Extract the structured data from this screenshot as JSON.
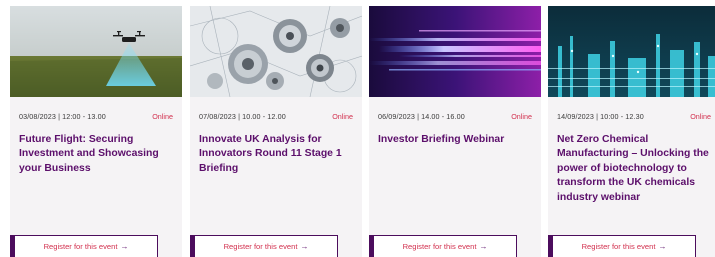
{
  "events": [
    {
      "date": "03/08/2023 | 12:00 - 13.00",
      "mode": "Online",
      "title": "Future Flight: Securing Investment and Showcasing your Business",
      "register_label": "Register for this event",
      "register_arrow": "→",
      "image_icon": "drone-over-field-image"
    },
    {
      "date": "07/08/2023 | 10.00 - 12.00",
      "mode": "Online",
      "title": "Innovate UK Analysis for Innovators Round 11 Stage 1 Briefing",
      "register_label": "Register for this event",
      "register_arrow": "→",
      "image_icon": "gears-blueprint-image"
    },
    {
      "date": "06/09/2023 | 14.00 - 16.00",
      "mode": "Online",
      "title": "Investor Briefing Webinar",
      "register_label": "Register for this event",
      "register_arrow": "→",
      "image_icon": "light-streaks-image"
    },
    {
      "date": "14/09/2023 | 10:00 - 12.30",
      "mode": "Online",
      "title": "Net Zero Chemical Manufacturing – Unlocking the power of biotechnology to transform the UK chemicals industry webinar",
      "register_label": "Register for this event",
      "register_arrow": "→",
      "image_icon": "chemical-plant-night-image"
    }
  ],
  "colors": {
    "title": "#5c0f6b",
    "online": "#d2314f",
    "card_bg": "#f5f3f5",
    "button_border": "#4c0d5d"
  }
}
